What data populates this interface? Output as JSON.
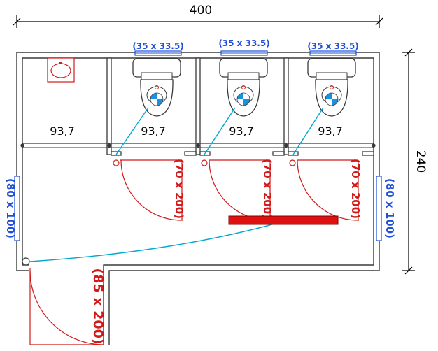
{
  "dimensions": {
    "overall_width": "400",
    "overall_depth": "240"
  },
  "rooms": [
    {
      "label": "93,7"
    },
    {
      "label": "93,7"
    },
    {
      "label": "93,7"
    },
    {
      "label": "93,7"
    }
  ],
  "toilet_windows": [
    {
      "label": "(35 x 33.5)"
    },
    {
      "label": "(35 x 33.5)"
    },
    {
      "label": "(35 x 33.5)"
    }
  ],
  "stall_doors": [
    {
      "label": "(70 x 200)"
    },
    {
      "label": "(70 x 200)"
    },
    {
      "label": "(70 x 200)"
    }
  ],
  "side_windows": {
    "left": "(80 x 100)",
    "right": "(80 x 100)"
  },
  "main_door": {
    "label": "(85 x 200)"
  },
  "colors": {
    "wall": "#3a3a3a",
    "door_swing": "#d11a1a",
    "window": "#1f4fd8",
    "plumbing": "#00a8d0",
    "bench": "#e01010"
  }
}
